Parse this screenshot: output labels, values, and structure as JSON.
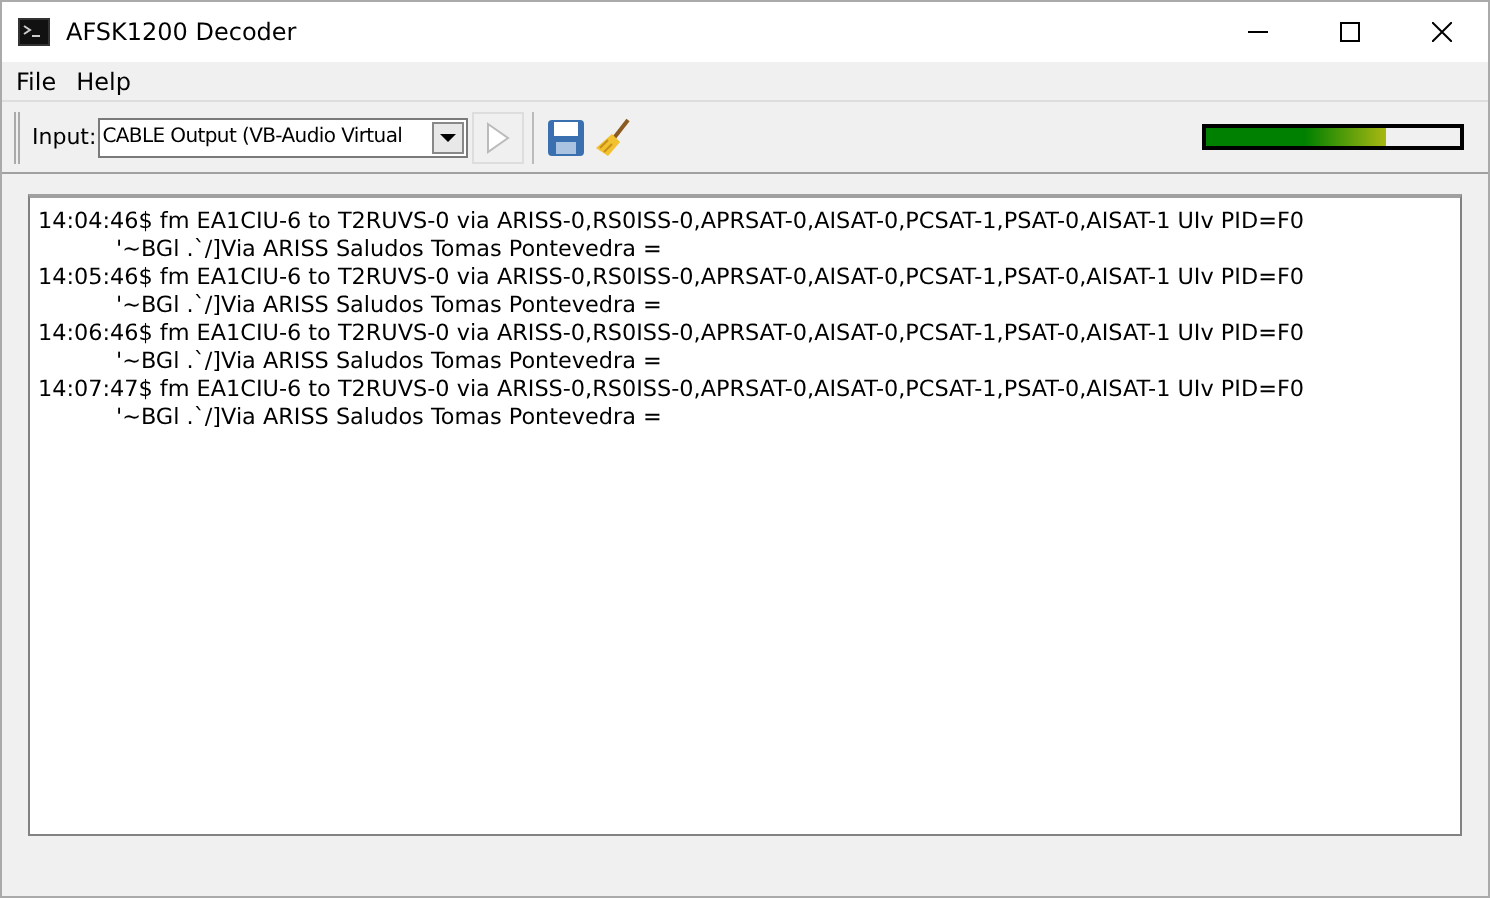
{
  "window": {
    "title": "AFSK1200 Decoder"
  },
  "menu": [
    "File",
    "Help"
  ],
  "toolbar": {
    "input_label": "Input:",
    "input_value": "CABLE Output (VB-Audio Virtual",
    "play_disabled": true,
    "meter": {
      "level": 0.71
    }
  },
  "log": [
    {
      "header": "14:04:46$ fm EA1CIU-6 to T2RUVS-0 via ARISS-0,RS0ISS-0,APRSAT-0,AISAT-0,PCSAT-1,PSAT-0,AISAT-1 UIv PID=F0",
      "body": "'~BGl .`/]Via ARISS Saludos Tomas Pontevedra ="
    },
    {
      "header": "14:05:46$ fm EA1CIU-6 to T2RUVS-0 via ARISS-0,RS0ISS-0,APRSAT-0,AISAT-0,PCSAT-1,PSAT-0,AISAT-1 UIv PID=F0",
      "body": "'~BGl .`/]Via ARISS Saludos Tomas Pontevedra ="
    },
    {
      "header": "14:06:46$ fm EA1CIU-6 to T2RUVS-0 via ARISS-0,RS0ISS-0,APRSAT-0,AISAT-0,PCSAT-1,PSAT-0,AISAT-1 UIv PID=F0",
      "body": "'~BGl .`/]Via ARISS Saludos Tomas Pontevedra ="
    },
    {
      "header": "14:07:47$ fm EA1CIU-6 to T2RUVS-0 via ARISS-0,RS0ISS-0,APRSAT-0,AISAT-0,PCSAT-1,PSAT-0,AISAT-1 UIv PID=F0",
      "body": "'~BGl .`/]Via ARISS Saludos Tomas Pontevedra ="
    }
  ]
}
